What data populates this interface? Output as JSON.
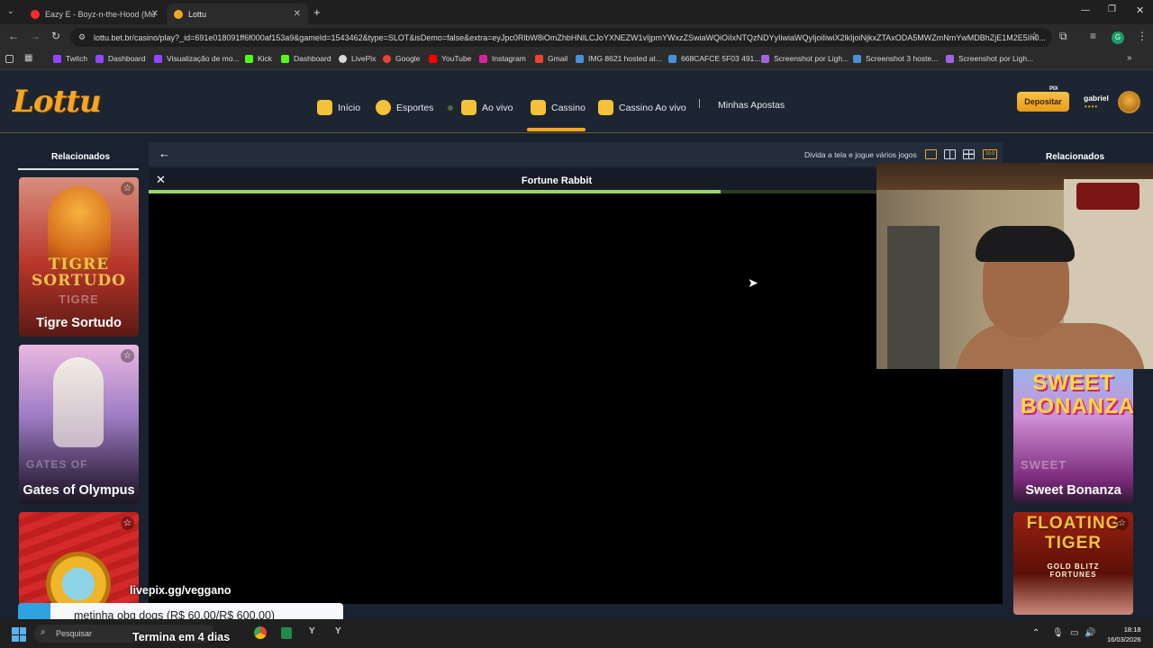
{
  "browser": {
    "tabs": [
      {
        "title": "Eazy E - Boyz-n-the-Hood (Mu",
        "active": false
      },
      {
        "title": "Lottu",
        "active": true
      }
    ],
    "url": "lottu.bet.br/casino/play?_id=691e018091ff6f000af153a9&gameId=1543462&type=SLOT&isDemo=false&extra=eyJpc0RlbW8iOmZhbHNlLCJoYXNEZW1vIjpmYWxzZSwiaWQiOiIxNTQzNDYyIiwiaWQyIjoiIiwiX2lkIjoiNjkxZTAxODA5MWZmNmYwMDBhZjE1M2E5In0...",
    "bookmarks": [
      "Twitch",
      "Dashboard",
      "Visualização de mo...",
      "Kick",
      "Dashboard",
      "LivePix",
      "Google",
      "YouTube",
      "Instagram",
      "Gmail",
      "IMG 8621 hosted at...",
      "668CAFCE 5F03 491...",
      "Screenshot por Ligh...",
      "Screenshot 3 hoste...",
      "Screenshot por Ligh..."
    ]
  },
  "site": {
    "logo": "Lottu",
    "nav": [
      "Início",
      "Esportes",
      "Ao vivo",
      "Cassino",
      "Cassino Ao vivo",
      "Minhas Apostas"
    ],
    "active_nav": "Cassino",
    "pix_badge": "PIX",
    "deposit_label": "Depositar",
    "username": "gabriel",
    "balance_mask": "••••"
  },
  "sidebar_left": {
    "heading": "Relacionados",
    "games": [
      {
        "name": "Tigre Sortudo",
        "art_text": "TIGRE SORTUDO",
        "art_sub": "TIGRE",
        "colors": [
          "#e8b3a5",
          "#b22a20"
        ]
      },
      {
        "name": "Gates of Olympus",
        "art_text": "",
        "art_sub": "GATES OF",
        "colors": [
          "#e6a6d8",
          "#6a4a9a"
        ]
      },
      {
        "name": "",
        "art_text": "",
        "art_sub": "",
        "colors": [
          "#d42a2a",
          "#a61414"
        ]
      }
    ]
  },
  "sidebar_right": {
    "heading": "Relacionados",
    "games": [
      {
        "name": "Sweet Bonanza",
        "art_text": "SWEET BONANZA",
        "art_sub": "SWEET",
        "colors": [
          "#7fc6f0",
          "#c03aa0"
        ]
      },
      {
        "name": "",
        "art_text": "FLOATING TIGER",
        "art_sub": "GOLD BLITZ FORTUNES",
        "colors": [
          "#8a2010",
          "#3a0a08"
        ]
      }
    ]
  },
  "game": {
    "split_label": "Divida a tela e jogue vários jogos",
    "layout_options": [
      "single",
      "double",
      "quad",
      "16:9"
    ],
    "title": "Fortune Rabbit",
    "load_progress": 0.67
  },
  "overlay": {
    "livepix": "livepix.gg/veggano",
    "donation": "metinha obg dogs (R$ 60,00/R$ 600,00)",
    "timer": "Termina em 4 dias"
  },
  "taskbar": {
    "search_placeholder": "Pesquisar",
    "time": "18:18",
    "date": "16/03/2026"
  }
}
